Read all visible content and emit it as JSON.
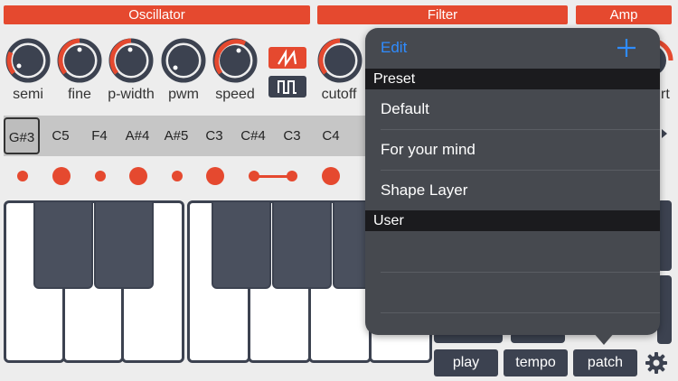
{
  "sections": {
    "oscillator": "Oscillator",
    "filter": "Filter",
    "amp": "Amp"
  },
  "knobs": {
    "semi": "semi",
    "fine": "fine",
    "p_width": "p-width",
    "pwm": "pwm",
    "speed": "speed",
    "cutoff": "cutoff",
    "partial_right": "rt"
  },
  "notes": [
    "G#3",
    "C5",
    "F4",
    "A#4",
    "A#5",
    "C3",
    "C#4",
    "C3",
    "C4"
  ],
  "bottom_buttons": {
    "play": "play",
    "tempo": "tempo",
    "patch": "patch"
  },
  "popover": {
    "edit_label": "Edit",
    "preset_header": "Preset",
    "presets": [
      "Default",
      "For your mind",
      "Shape Layer"
    ],
    "user_header": "User"
  },
  "colors": {
    "accent": "#e5492f",
    "dark": "#3c4250",
    "link": "#2f8cff"
  }
}
